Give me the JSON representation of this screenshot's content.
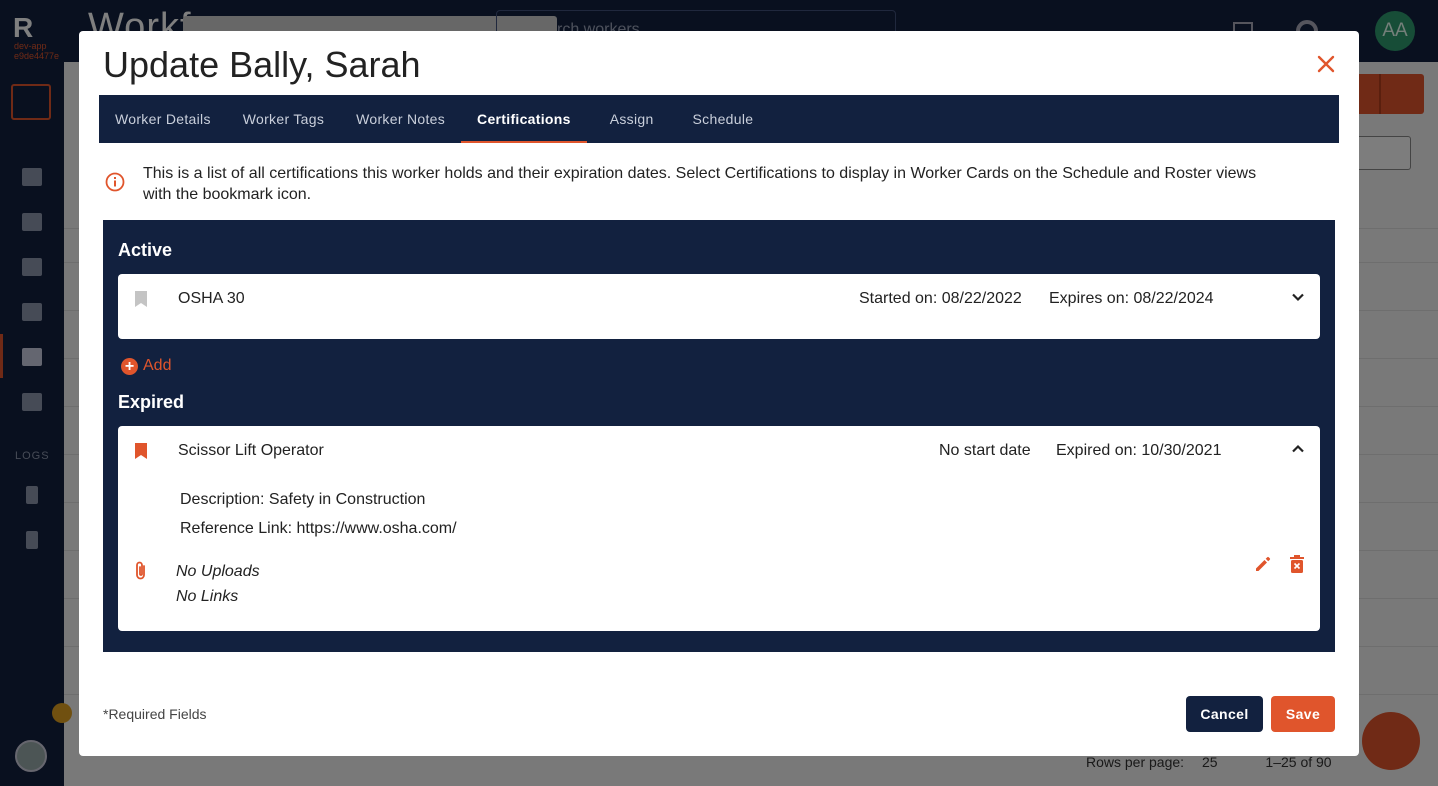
{
  "background": {
    "logo": "R",
    "env_line1": "dev-app",
    "env_line2": "e9de4477e",
    "app_title": "Workf",
    "search_placeholder": "rch workers",
    "avatar_initials": "AA",
    "logs_label": "LOGS",
    "pager": {
      "rows_label": "Rows per page:",
      "rows_value": "25",
      "range": "1–25 of 90"
    }
  },
  "modal": {
    "title": "Update Bally, Sarah",
    "tabs": [
      {
        "label": "Worker Details",
        "active": false
      },
      {
        "label": "Worker Tags",
        "active": false
      },
      {
        "label": "Worker Notes",
        "active": false
      },
      {
        "label": "Certifications",
        "active": true
      },
      {
        "label": "Assign",
        "active": false
      },
      {
        "label": "Schedule",
        "active": false
      }
    ],
    "info_text": "This is a list of all certifications this worker holds and their expiration dates. Select Certifications to display in Worker Cards on the Schedule and Roster views with the bookmark icon.",
    "active_heading": "Active",
    "active_cert": {
      "name": "OSHA 30",
      "start": "Started on: 08/22/2022",
      "expires": "Expires on: 08/22/2024",
      "bookmarked": false
    },
    "add_label": "Add",
    "expired_heading": "Expired",
    "expired_cert": {
      "name": "Scissor Lift Operator",
      "start": "No start date",
      "expires": "Expired on: 10/30/2021",
      "bookmarked": true,
      "description": "Description: Safety in Construction",
      "reference": "Reference Link: https://www.osha.com/",
      "uploads": "No Uploads",
      "links": "No Links"
    },
    "required_note": "*Required Fields",
    "cancel_label": "Cancel",
    "save_label": "Save"
  },
  "colors": {
    "navy": "#12213f",
    "accent": "#e0552c",
    "bookmark_inactive": "#c4c4c4"
  }
}
